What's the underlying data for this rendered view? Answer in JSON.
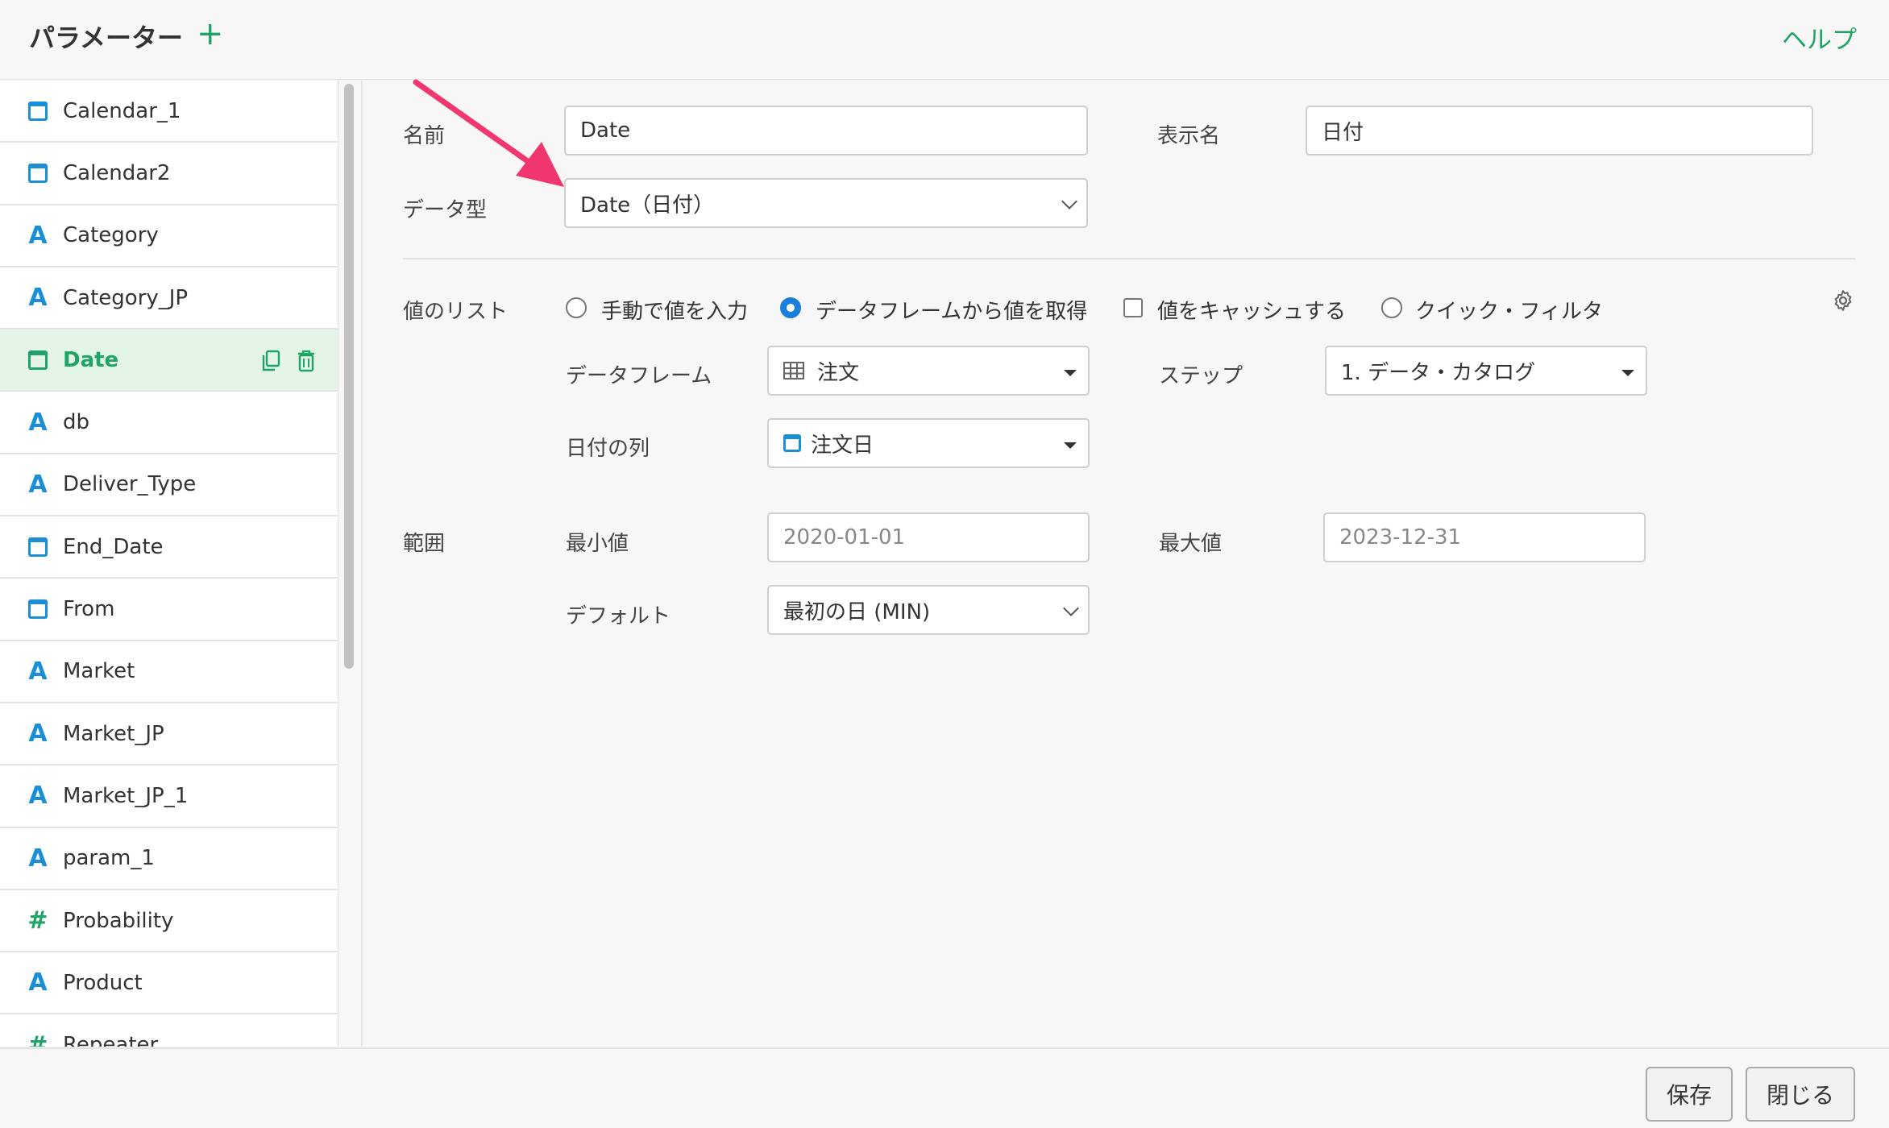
{
  "header": {
    "title": "パラメーター",
    "add_label": "+",
    "help_label": "ヘルプ"
  },
  "sidebar": {
    "items": [
      {
        "label": "Calendar_1",
        "type": "date"
      },
      {
        "label": "Calendar2",
        "type": "date"
      },
      {
        "label": "Category",
        "type": "character"
      },
      {
        "label": "Category_JP",
        "type": "character"
      },
      {
        "label": "Date",
        "type": "date",
        "active": true
      },
      {
        "label": "db",
        "type": "character"
      },
      {
        "label": "Deliver_Type",
        "type": "character"
      },
      {
        "label": "End_Date",
        "type": "date"
      },
      {
        "label": "From",
        "type": "date"
      },
      {
        "label": "Market",
        "type": "character"
      },
      {
        "label": "Market_JP",
        "type": "character"
      },
      {
        "label": "Market_JP_1",
        "type": "character"
      },
      {
        "label": "param_1",
        "type": "character"
      },
      {
        "label": "Probability",
        "type": "numeric"
      },
      {
        "label": "Product",
        "type": "character"
      },
      {
        "label": "Repeater",
        "type": "numeric"
      }
    ],
    "type_glyphs": {
      "character": "A",
      "numeric": "#"
    }
  },
  "form": {
    "name_label": "名前",
    "name_value": "Date",
    "display_name_label": "表示名",
    "display_name_value": "日付",
    "data_type_label": "データ型",
    "data_type_value": "Date（日付）",
    "value_list_label": "値のリスト",
    "options": {
      "manual": "手動で値を入力",
      "from_dataframe": "データフレームから値を取得",
      "cache": "値をキャッシュする",
      "quick_filter": "クイック・フィルタ"
    },
    "dataframe_label": "データフレーム",
    "dataframe_value": "注文",
    "step_label": "ステップ",
    "step_value": "1. データ・カタログ",
    "date_column_label": "日付の列",
    "date_column_value": "注文日",
    "range_label": "範囲",
    "min_label": "最小値",
    "min_value": "2020-01-01",
    "max_label": "最大値",
    "max_value": "2023-12-31",
    "default_label": "デフォルト",
    "default_value": "最初の日 (MIN)"
  },
  "footer": {
    "save_label": "保存",
    "close_label": "閉じる"
  },
  "colors": {
    "accent_green": "#1fa366",
    "accent_blue": "#1a8fd6",
    "arrow_pink": "#f2366f",
    "active_row_bg": "#e2f5e7"
  }
}
